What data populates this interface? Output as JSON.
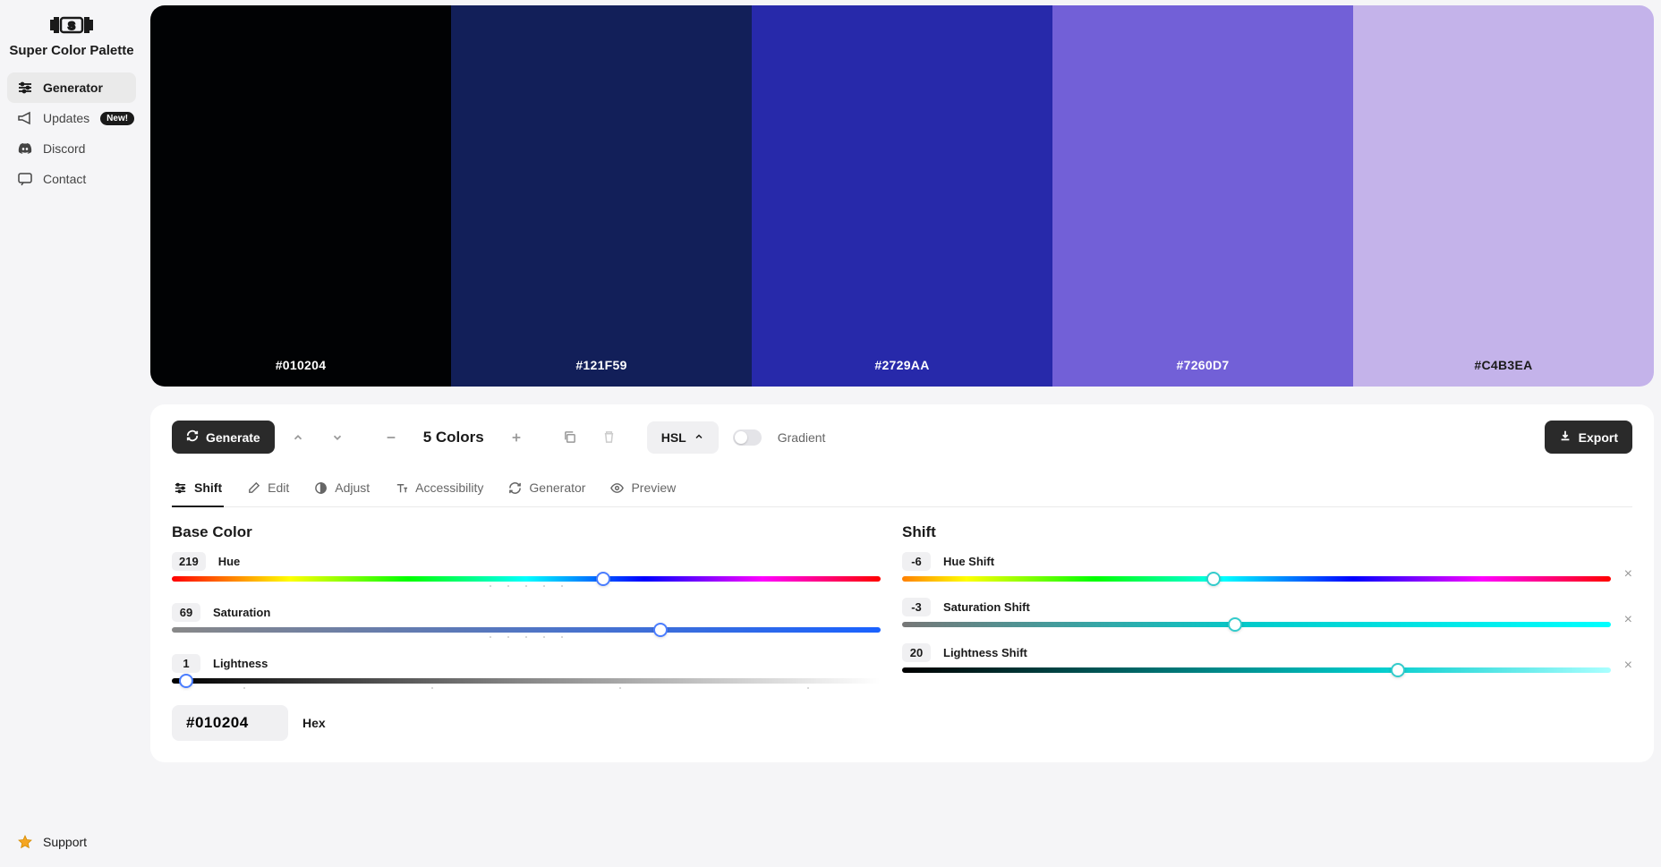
{
  "app_name": "Super Color Palette",
  "sidebar": {
    "items": [
      {
        "label": "Generator",
        "active": true
      },
      {
        "label": "Updates",
        "badge": "New!"
      },
      {
        "label": "Discord"
      },
      {
        "label": "Contact"
      }
    ],
    "support_label": "Support"
  },
  "palette": {
    "colors": [
      {
        "hex": "#010204",
        "text_color": "#ffffff"
      },
      {
        "hex": "#121F59",
        "text_color": "#ffffff"
      },
      {
        "hex": "#2729AA",
        "text_color": "#ffffff"
      },
      {
        "hex": "#7260D7",
        "text_color": "#ffffff"
      },
      {
        "hex": "#C4B3EA",
        "text_color": "#1a1a1a"
      }
    ]
  },
  "toolbar": {
    "generate_label": "Generate",
    "colors_count": "5 Colors",
    "color_mode": "HSL",
    "gradient_label": "Gradient",
    "gradient_on": false,
    "export_label": "Export"
  },
  "tabs": [
    {
      "label": "Shift",
      "active": true
    },
    {
      "label": "Edit"
    },
    {
      "label": "Adjust"
    },
    {
      "label": "Accessibility"
    },
    {
      "label": "Generator"
    },
    {
      "label": "Preview"
    }
  ],
  "base_color": {
    "title": "Base Color",
    "hue": {
      "label": "Hue",
      "value": "219",
      "pct": 60.8
    },
    "saturation": {
      "label": "Saturation",
      "value": "69",
      "pct": 69
    },
    "lightness": {
      "label": "Lightness",
      "value": "1",
      "pct": 1
    },
    "hex_value": "#010204",
    "hex_label": "Hex"
  },
  "shift": {
    "title": "Shift",
    "hue_shift": {
      "label": "Hue Shift",
      "value": "-6",
      "pct": 44
    },
    "saturation_shift": {
      "label": "Saturation Shift",
      "value": "-3",
      "pct": 47
    },
    "lightness_shift": {
      "label": "Lightness Shift",
      "value": "20",
      "pct": 70
    }
  }
}
